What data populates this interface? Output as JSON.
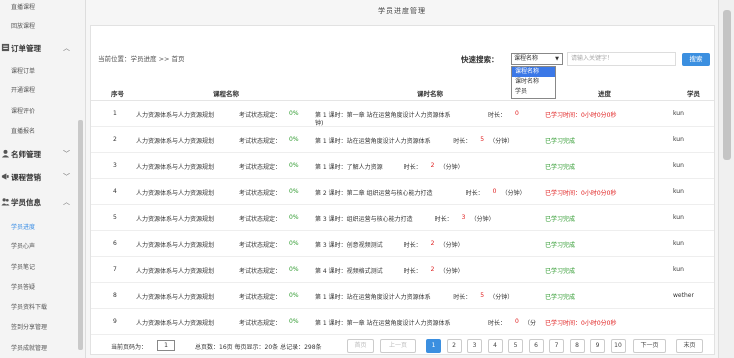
{
  "sidebar": {
    "items_top": [
      "直播课程",
      "回放课程"
    ],
    "group_orders": "订单管理",
    "orders_items": [
      "课程订单",
      "开通课程",
      "课程评价",
      "直播报名"
    ],
    "group_teacher": "名师管理",
    "group_marketing": "课程营销",
    "group_students": "学员信息",
    "student_items": [
      "学员进度",
      "学员心声",
      "学员笔记",
      "学员答疑",
      "学员资料下载",
      "签到分享管理",
      "学员成就管理"
    ]
  },
  "page_title": "学员进度管理",
  "breadcrumb": "当前位置：学员进度 >> 首页",
  "search": {
    "label": "快速搜索：",
    "selected": "课程名称",
    "options": [
      "课程名称",
      "课时名称",
      "学员"
    ],
    "placeholder": "请输入关键字！",
    "button": "搜索"
  },
  "table": {
    "headers": [
      "序号",
      "课程名称",
      "课时名称",
      "进度",
      "学员"
    ],
    "rows": [
      {
        "no": "1",
        "course": "人力资源体系与人力资源规划",
        "exam": "考试状态规定：",
        "pct": "0%",
        "lesson1": "第 1 课时：第一章  站在运营角度设计人力资源体系",
        "dur": "时长：",
        "mins": "0",
        "lesson2": "钟)",
        "progress": "已学习时间：0小时0分0秒",
        "pstate": "red",
        "user": "kun"
      },
      {
        "no": "2",
        "course": "人力资源体系与人力资源规划",
        "exam": "考试状态规定：",
        "pct": "0%",
        "lesson1": "第 1 课时：站在运营角度设计人力资源体系",
        "dur": "时长：",
        "mins": "5",
        "lesson2": "",
        "unit": "（分钟）",
        "progress": "已学习完成",
        "pstate": "ok",
        "user": "kun"
      },
      {
        "no": "3",
        "course": "人力资源体系与人力资源规划",
        "exam": "考试状态规定：",
        "pct": "0%",
        "lesson1": "第 1 课时：了解人力资源",
        "dur": "时长：",
        "mins": "2",
        "lesson2": "",
        "unit": "（分钟）",
        "progress": "已学习完成",
        "pstate": "ok",
        "user": "kun"
      },
      {
        "no": "4",
        "course": "人力资源体系与人力资源规划",
        "exam": "考试状态规定：",
        "pct": "0%",
        "lesson1": "第 2 课时：第二章  组织运营与核心能力打造",
        "dur": "时长：",
        "mins": "0",
        "lesson2": "",
        "unit": "（分钟）",
        "progress": "已学习时间：0小时0分0秒",
        "pstate": "red",
        "user": "kun"
      },
      {
        "no": "5",
        "course": "人力资源体系与人力资源规划",
        "exam": "考试状态规定：",
        "pct": "0%",
        "lesson1": "第 3 课时：组织运营与核心能力打造",
        "dur": "时长：",
        "mins": "3",
        "lesson2": "",
        "unit": "（分钟）",
        "progress": "已学习完成",
        "pstate": "ok",
        "user": "kun"
      },
      {
        "no": "6",
        "course": "人力资源体系与人力资源规划",
        "exam": "考试状态规定：",
        "pct": "0%",
        "lesson1": "第 3 课时：创意视频测试",
        "dur": "时长：",
        "mins": "2",
        "lesson2": "",
        "unit": "（分钟）",
        "progress": "已学习完成",
        "pstate": "ok",
        "user": "kun"
      },
      {
        "no": "7",
        "course": "人力资源体系与人力资源规划",
        "exam": "考试状态规定：",
        "pct": "0%",
        "lesson1": "第 4 课时：视频格式测试",
        "dur": "时长：",
        "mins": "2",
        "lesson2": "",
        "unit": "（分钟）",
        "progress": "已学习完成",
        "pstate": "ok",
        "user": "kun"
      },
      {
        "no": "8",
        "course": "人力资源体系与人力资源规划",
        "exam": "考试状态规定：",
        "pct": "0%",
        "lesson1": "第 1 课时：站在运营角度设计人力资源体系",
        "dur": "时长：",
        "mins": "5",
        "lesson2": "",
        "unit": "（分钟）",
        "progress": "已学习完成",
        "pstate": "ok",
        "user": "wether"
      },
      {
        "no": "9",
        "course": "人力资源体系与人力资源规划",
        "exam": "考试状态规定：",
        "pct": "0%",
        "lesson1": "第 1 课时：第一章  站在运营角度设计人力资源体系",
        "dur": "时长：",
        "mins": "0",
        "lesson2": "",
        "unit": "（分",
        "progress": "已学习时间：0小时0分0秒",
        "pstate": "red",
        "user": ""
      }
    ]
  },
  "pager": {
    "current_label": "当前页码为：",
    "current_value": "1",
    "summary": "总页数：16页  每页显示：20条  总记录：298条",
    "first": "首页",
    "prev": "上一页",
    "pages": [
      "1",
      "2",
      "3",
      "4",
      "5",
      "6",
      "7",
      "8",
      "9",
      "10"
    ],
    "next": "下一页",
    "last": "末页"
  },
  "colors": {
    "accent": "#3b8fe0",
    "done": "#2e9a2e",
    "warn": "#e02020"
  }
}
